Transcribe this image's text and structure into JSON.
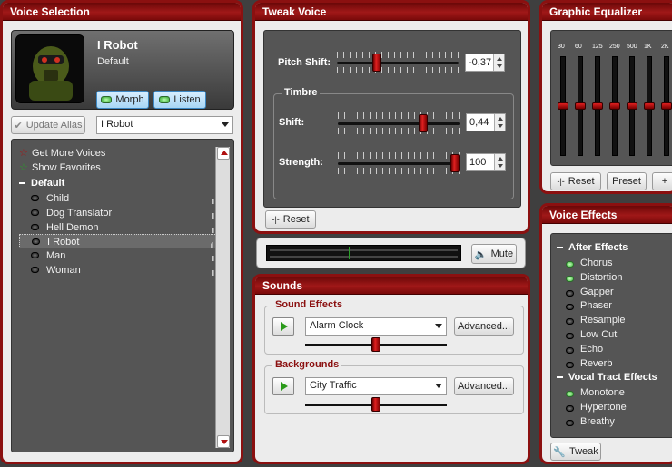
{
  "voice_selection": {
    "title": "Voice Selection",
    "voice_name": "I Robot",
    "voice_sub": "Default",
    "morph_label": "Morph",
    "listen_label": "Listen",
    "update_alias_label": "Update Alias",
    "alias_value": "I Robot",
    "links": [
      "Get More Voices",
      "Show Favorites"
    ],
    "group": "Default",
    "items": [
      "Child",
      "Dog Translator",
      "Hell Demon",
      "I Robot",
      "Man",
      "Woman"
    ],
    "selected_item": "I Robot"
  },
  "tweak_voice": {
    "title": "Tweak Voice",
    "pitch_label": "Pitch Shift:",
    "pitch_value": "-0,37",
    "pitch_level": -0.37,
    "timbre_title": "Timbre",
    "shift_label": "Shift:",
    "shift_value": "0,44",
    "shift_level": 0.44,
    "strength_label": "Strength:",
    "strength_value": "100",
    "strength_level": 100,
    "reset_label": "Reset"
  },
  "output": {
    "mute_label": "Mute"
  },
  "sounds": {
    "title": "Sounds",
    "effects_title": "Sound Effects",
    "effect_value": "Alarm Clock",
    "effect_level": 0.5,
    "advanced_label": "Advanced...",
    "backgrounds_title": "Backgrounds",
    "background_value": "City Traffic",
    "background_level": 0.5,
    "advanced2_label": "Advanced..."
  },
  "equalizer": {
    "title": "Graphic Equalizer",
    "bands": [
      "30",
      "60",
      "125",
      "250",
      "500",
      "1K",
      "2K"
    ],
    "reset_label": "Reset",
    "preset_label": "Preset",
    "add_label": "+"
  },
  "voice_effects": {
    "title": "Voice Effects",
    "after_title": "After Effects",
    "after_items": [
      {
        "label": "Chorus",
        "on": true
      },
      {
        "label": "Distortion",
        "on": true
      },
      {
        "label": "Gapper",
        "on": false
      },
      {
        "label": "Phaser",
        "on": false
      },
      {
        "label": "Resample",
        "on": false
      },
      {
        "label": "Low Cut",
        "on": false
      },
      {
        "label": "Echo",
        "on": false
      },
      {
        "label": "Reverb",
        "on": false
      }
    ],
    "vocal_title": "Vocal Tract Effects",
    "vocal_items": [
      {
        "label": "Monotone",
        "on": true
      },
      {
        "label": "Hypertone",
        "on": false
      },
      {
        "label": "Breathy",
        "on": false
      }
    ],
    "tweak_label": "Tweak"
  },
  "colors": {
    "accent": "#8b1010",
    "title_bar": "#a01818",
    "led_on": "#39b535"
  }
}
